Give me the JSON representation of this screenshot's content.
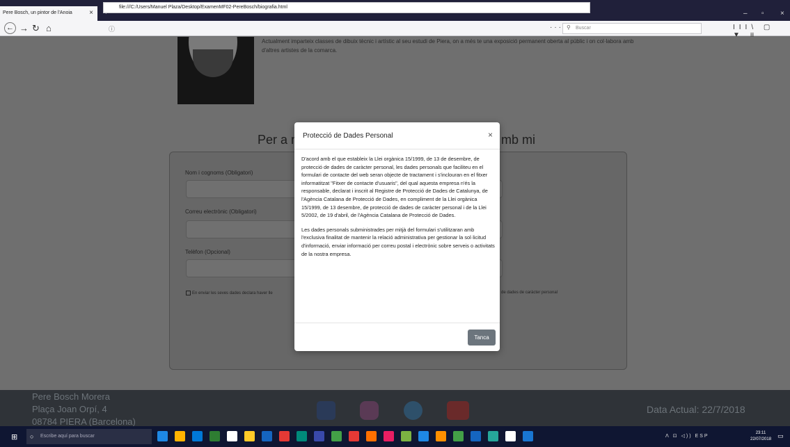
{
  "browser": {
    "tab_title": "Pere Bosch, un pintor de l'Anoia",
    "tab_close": "×",
    "new_tab": "+",
    "url": "file:///C:/Users/Manuel Plaza/Desktop/ExamenMF02-PereBosch/biografia.html",
    "search_placeholder": "Buscar",
    "page_actions": "··· ▼ ☆",
    "tools": "III\\ ▢ ▼ ≡",
    "win_min": "–",
    "win_max": "▫",
    "win_close": "×"
  },
  "page": {
    "bio_text": "Actualment imparteix classes de dibuix tècnic i artístic al seu estudi de Piera, on a més te una exposició permanent oberta al públic i on col·labora amb d'altres artistes de la comarca.",
    "contact_heading_left": "Per a m",
    "contact_heading_right": "mb mi",
    "form": {
      "name_label": "Nom i cognoms (Obligatori)",
      "email_label": "Correu electrònic (Obligatori)",
      "phone_label": "Telèfon (Opcional)",
      "consent_text": "En enviar les seves dades declara haver lle",
      "consent_tail": "de dades de caràcter personal"
    },
    "footer": {
      "name": "Pere Bosch Morera",
      "street": "Plaça Joan Orpí, 4",
      "city": "08784 PIERA (Barcelona)",
      "date": "Data Actual: 22/7/2018"
    }
  },
  "modal": {
    "title": "Protecció de Dades Personal",
    "close": "×",
    "paragraph1": "D'acord amb el que estableix la Llei orgànica 15/1999, de 13 de desembre, de protecció de dades de caràcter personal, les dades personals que faciliteu en el formulari de contacte del web seran objecte de tractament i s'inclouran en el fitxer informatitzat \"Fitxer de contacte d'usuaris\", del qual aquesta empresa n'és la responsable, declarat i inscrit al Registre de Protecció de Dades de Catalunya, de l'Agència Catalana de Protecció de Dades, en compliment de la Llei orgànica 15/1999, de 13 desembre, de protecció de dades de caràcter personal i de la Llei 5/2002, de 19 d'abril, de l'Agència Catalana de Protecció de Dades.",
    "paragraph2": "Les dades personals subministrades per mitjà del formulari s'utilitzaran amb l'exclusiva finalitat de mantenir la relació administrativa per gestionar la sol·licitud d'informació, enviar informació per correu postal i electrònic sobre serveis o activitats de la nostra empresa.",
    "button": "Tanca"
  },
  "taskbar": {
    "search_placeholder": "Escribe aquí para buscar",
    "tray": "ᐱ ⊡ ◁)) ESP",
    "time": "23:11",
    "date": "22/07/2018",
    "app_colors": [
      "#1e88e5",
      "#ffb300",
      "#0078d7",
      "#2e7d32",
      "#ffffff",
      "#ffca28",
      "#1565c0",
      "#e53935",
      "#00897b",
      "#3949ab",
      "#43a047",
      "#e53935",
      "#ff6f00",
      "#e91e63",
      "#7cb342",
      "#1e88e5",
      "#ff8f00",
      "#43a047",
      "#1565c0",
      "#26a69a",
      "#ffffff",
      "#1976d2"
    ]
  }
}
